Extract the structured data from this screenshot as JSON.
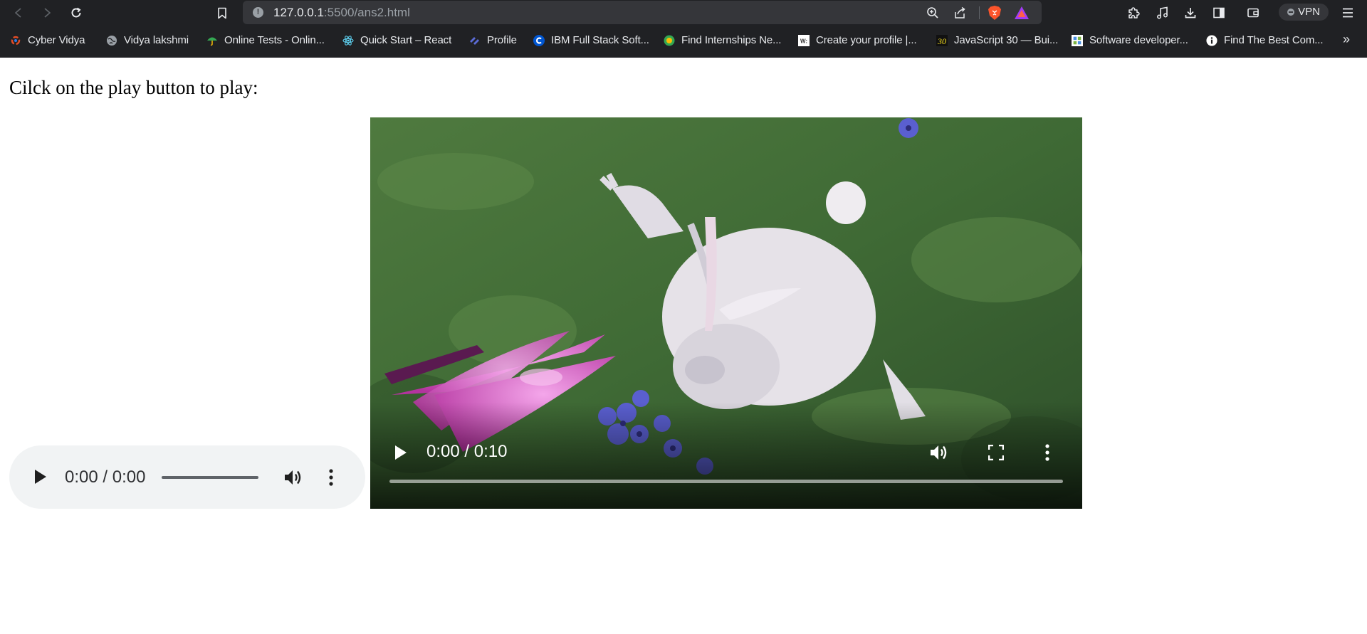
{
  "browser": {
    "url_host": "127.0.0.1",
    "url_path": ":5500/ans2.html",
    "vpn_label": "VPN",
    "bookmarks": [
      {
        "label": "Cyber Vidya",
        "icon": "cyber-vidya-icon"
      },
      {
        "label": "Vidya lakshmi",
        "icon": "globe-icon"
      },
      {
        "label": "Online Tests - Onlin...",
        "icon": "umbrella-icon"
      },
      {
        "label": "Quick Start – React",
        "icon": "react-icon"
      },
      {
        "label": "Profile",
        "icon": "profile-logo-icon"
      },
      {
        "label": "IBM Full Stack Soft...",
        "icon": "coursera-icon"
      },
      {
        "label": "Find Internships Ne...",
        "icon": "internship-icon"
      },
      {
        "label": "Create your profile |...",
        "icon": "w-icon"
      },
      {
        "label": "JavaScript 30 — Bui...",
        "icon": "js30-icon"
      },
      {
        "label": "Software developer...",
        "icon": "naukri-icon"
      },
      {
        "label": "Find The Best Com...",
        "icon": "info-icon"
      }
    ],
    "more_bookmarks": "»",
    "colors": {
      "chrome_bg": "#202124",
      "omnibox_bg": "#35363a",
      "brave_orange": "#fb542b"
    }
  },
  "page": {
    "heading": "Cilck on the play button to play:",
    "audio": {
      "time": "0:00 / 0:00",
      "progress": 0
    },
    "video": {
      "time": "0:00 / 0:10",
      "progress": 0
    }
  }
}
